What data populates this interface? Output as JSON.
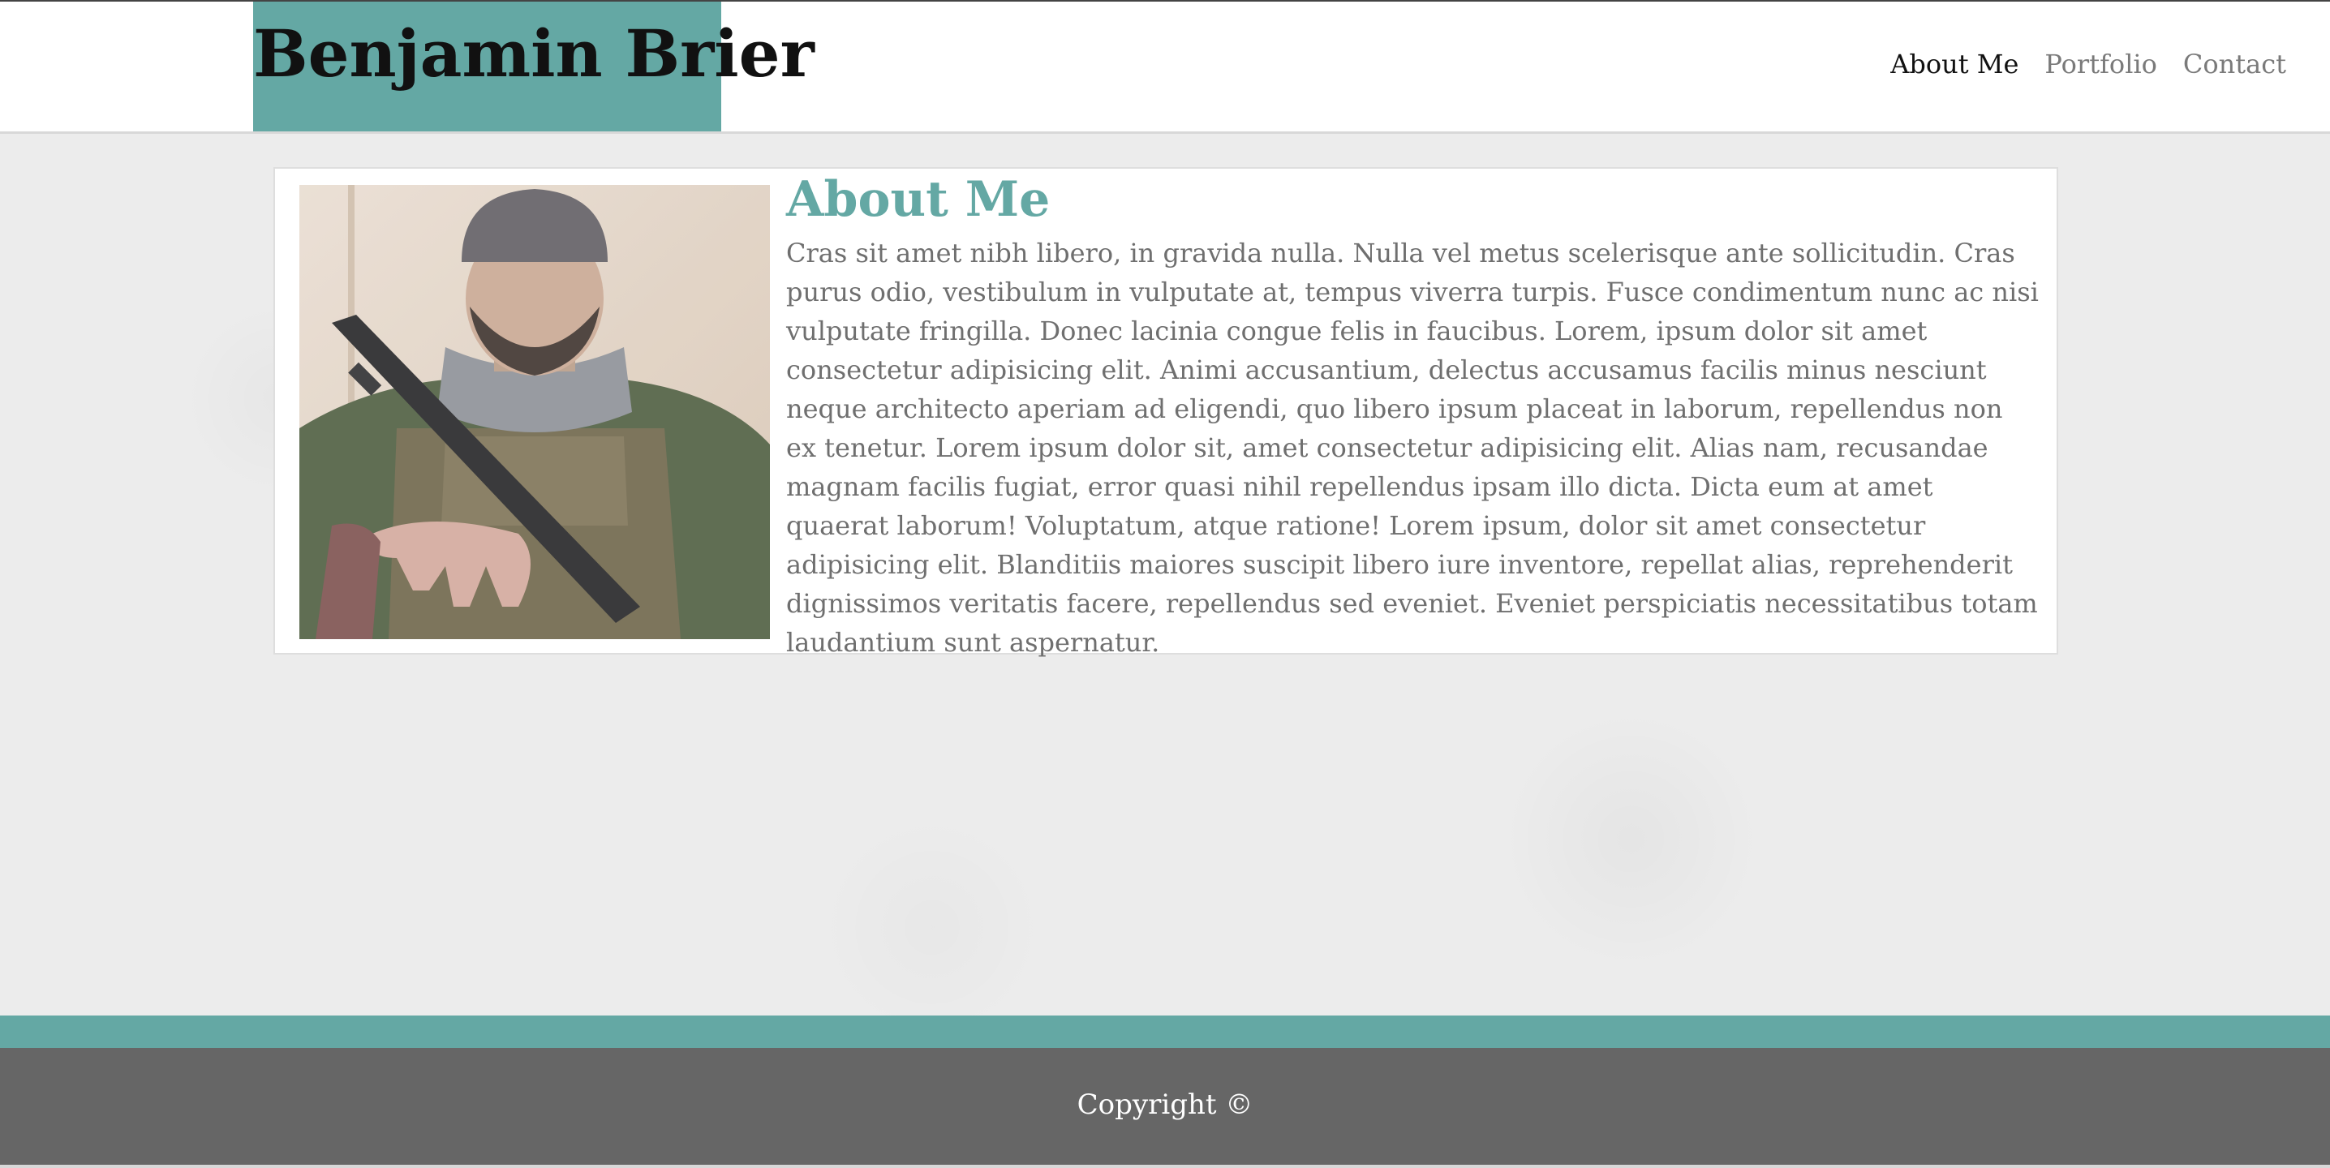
{
  "header": {
    "brand_title": "Benjamin Brier",
    "nav": [
      {
        "label": "About Me",
        "active": true
      },
      {
        "label": "Portfolio",
        "active": false
      },
      {
        "label": "Contact",
        "active": false
      }
    ]
  },
  "main": {
    "section_title": "About Me",
    "body_text": "Cras sit amet nibh libero, in gravida nulla. Nulla vel metus scelerisque ante sollicitudin. Cras purus odio, vestibulum in vulputate at, tempus viverra turpis. Fusce condimentum nunc ac nisi vulputate fringilla. Donec lacinia congue felis in faucibus. Lorem, ipsum dolor sit amet consectetur adipisicing elit. Animi accusantium, delectus accusamus facilis minus nesciunt neque architecto aperiam ad eligendi, quo libero ipsum placeat in laborum, repellendus non ex tenetur. Lorem ipsum dolor sit, amet consectetur adipisicing elit. Alias nam, recusandae magnam facilis fugiat, error quasi nihil repellendus ipsam illo dicta. Dicta eum at amet quaerat laborum! Voluptatum, atque ratione! Lorem ipsum, dolor sit amet consectetur adipisicing elit. Blanditiis maiores suscipit libero iure inventore, repellat alias, reprehenderit dignissimos veritatis facere, repellendus sed eveniet. Eveniet perspiciatis necessitatibus totam laudantium sunt aspernatur."
  },
  "footer": {
    "copyright": "Copyright ©"
  },
  "colors": {
    "accent": "#64a8a4",
    "footer_bg": "#666666",
    "page_bg": "#ececec"
  }
}
